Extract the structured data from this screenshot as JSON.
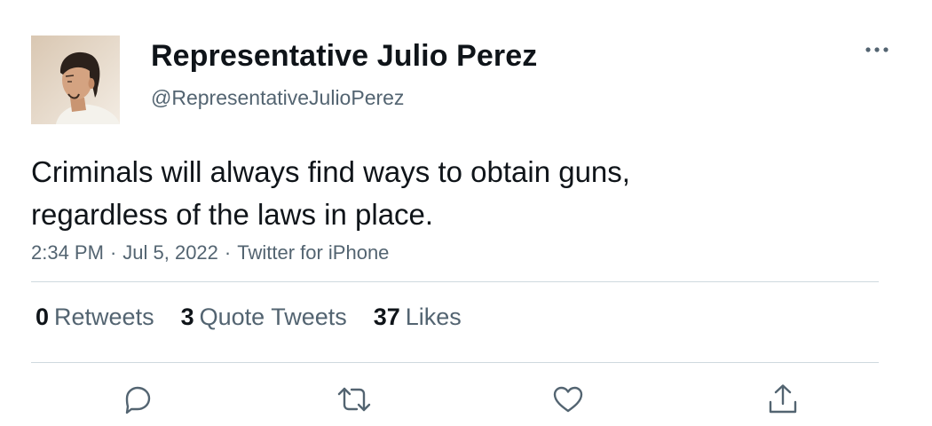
{
  "author": {
    "display_name": "Representative Julio Perez",
    "handle": "@RepresentativeJulioPerez"
  },
  "tweet": {
    "text_lines": [
      "Criminals will always find ways to obtain guns,",
      "regardless of the laws in place."
    ],
    "time": "2:34 PM",
    "date": "Jul 5, 2022",
    "separator": "·",
    "source": "Twitter for iPhone"
  },
  "stats": {
    "retweets": {
      "count": "0",
      "label": "Retweets"
    },
    "quote_tweets": {
      "count": "3",
      "label": "Quote Tweets"
    },
    "likes": {
      "count": "37",
      "label": "Likes"
    }
  },
  "actions": [
    "reply-icon",
    "retweet-icon",
    "like-icon",
    "share-icon"
  ],
  "colors": {
    "text_primary": "#0f1419",
    "text_secondary": "#536471",
    "divider": "#cfd9de"
  }
}
